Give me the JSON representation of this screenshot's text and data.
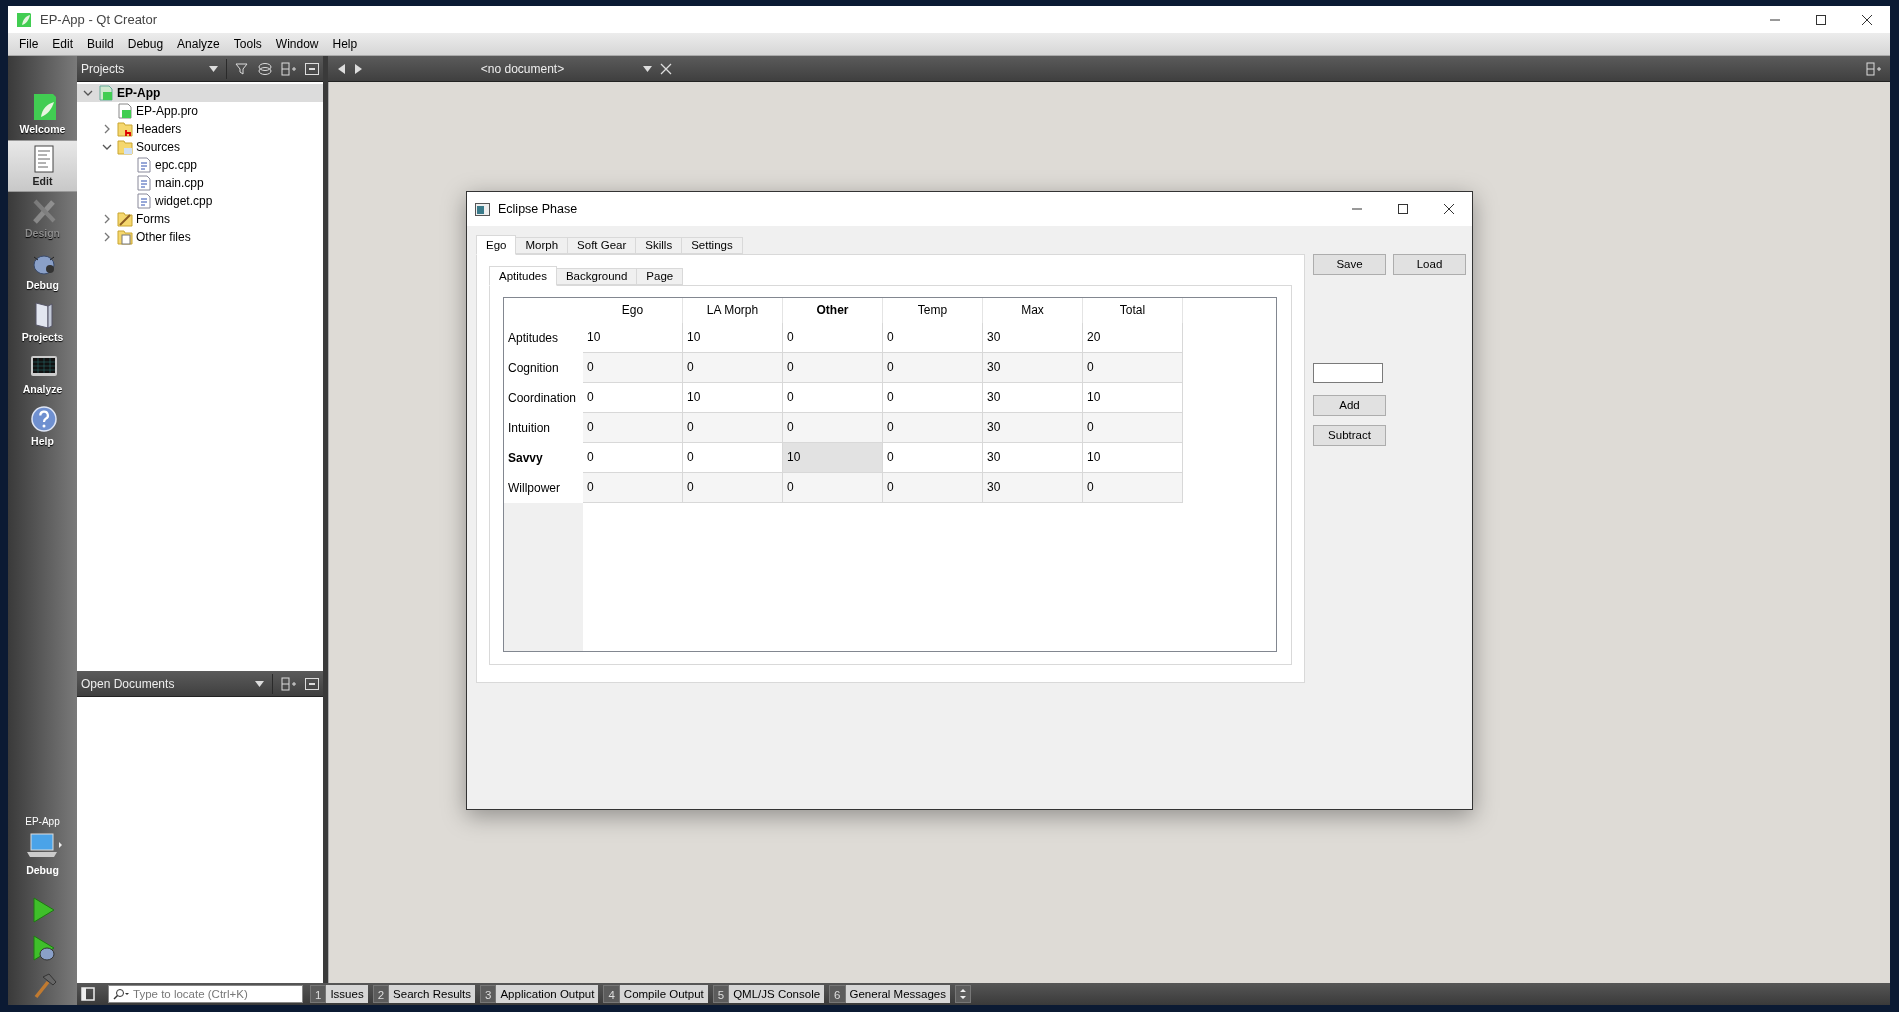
{
  "window": {
    "title": "EP-App - Qt Creator"
  },
  "menu": [
    "File",
    "Edit",
    "Build",
    "Debug",
    "Analyze",
    "Tools",
    "Window",
    "Help"
  ],
  "modes": [
    {
      "label": "Welcome",
      "kind": "welcome",
      "selected": false,
      "disabled": false
    },
    {
      "label": "Edit",
      "kind": "edit",
      "selected": true,
      "disabled": false
    },
    {
      "label": "Design",
      "kind": "design",
      "selected": false,
      "disabled": true
    },
    {
      "label": "Debug",
      "kind": "debug",
      "selected": false,
      "disabled": false
    },
    {
      "label": "Projects",
      "kind": "projects",
      "selected": false,
      "disabled": false
    },
    {
      "label": "Analyze",
      "kind": "analyze",
      "selected": false,
      "disabled": false
    },
    {
      "label": "Help",
      "kind": "help",
      "selected": false,
      "disabled": false
    }
  ],
  "target": {
    "project": "EP-App",
    "config": "Debug"
  },
  "projects_panel": {
    "title": "Projects",
    "tree": [
      {
        "label": "EP-App",
        "kind": "project",
        "selected": true,
        "expanded": true,
        "children": [
          {
            "label": "EP-App.pro",
            "kind": "pro",
            "selected": false
          },
          {
            "label": "Headers",
            "kind": "headers",
            "selected": false,
            "expanded": false
          },
          {
            "label": "Sources",
            "kind": "sources",
            "selected": false,
            "expanded": true,
            "children": [
              {
                "label": "epc.cpp",
                "kind": "cpp",
                "selected": false
              },
              {
                "label": "main.cpp",
                "kind": "cpp",
                "selected": false
              },
              {
                "label": "widget.cpp",
                "kind": "cpp",
                "selected": false
              }
            ]
          },
          {
            "label": "Forms",
            "kind": "forms",
            "selected": false,
            "expanded": false
          },
          {
            "label": "Other files",
            "kind": "other",
            "selected": false,
            "expanded": false
          }
        ]
      }
    ]
  },
  "open_documents": {
    "title": "Open Documents"
  },
  "editor": {
    "document": "<no document>"
  },
  "dialog": {
    "title": "Eclipse Phase",
    "tabs": [
      {
        "label": "Ego",
        "selected": true
      },
      {
        "label": "Morph",
        "selected": false
      },
      {
        "label": "Soft Gear",
        "selected": false
      },
      {
        "label": "Skills",
        "selected": false
      },
      {
        "label": "Settings",
        "selected": false
      }
    ],
    "subtabs": [
      {
        "label": "Aptitudes",
        "selected": true
      },
      {
        "label": "Background",
        "selected": false
      },
      {
        "label": "Page",
        "selected": false
      }
    ],
    "table": {
      "columns": [
        {
          "label": "Ego",
          "current": false
        },
        {
          "label": "LA Morph",
          "current": false
        },
        {
          "label": "Other",
          "current": true
        },
        {
          "label": "Temp",
          "current": false
        },
        {
          "label": "Max",
          "current": false
        },
        {
          "label": "Total",
          "current": false
        }
      ],
      "rows": [
        {
          "label": "Aptitudes",
          "current": false,
          "cells": [
            {
              "value": "10",
              "selected": false
            },
            {
              "value": "10",
              "selected": false
            },
            {
              "value": "0",
              "selected": false
            },
            {
              "value": "0",
              "selected": false
            },
            {
              "value": "30",
              "selected": false
            },
            {
              "value": "20",
              "selected": false
            }
          ]
        },
        {
          "label": "Cognition",
          "current": false,
          "cells": [
            {
              "value": "0",
              "selected": false
            },
            {
              "value": "0",
              "selected": false
            },
            {
              "value": "0",
              "selected": false
            },
            {
              "value": "0",
              "selected": false
            },
            {
              "value": "30",
              "selected": false
            },
            {
              "value": "0",
              "selected": false
            }
          ]
        },
        {
          "label": "Coordination",
          "current": false,
          "cells": [
            {
              "value": "0",
              "selected": false
            },
            {
              "value": "10",
              "selected": false
            },
            {
              "value": "0",
              "selected": false
            },
            {
              "value": "0",
              "selected": false
            },
            {
              "value": "30",
              "selected": false
            },
            {
              "value": "10",
              "selected": false
            }
          ]
        },
        {
          "label": "Intuition",
          "current": false,
          "cells": [
            {
              "value": "0",
              "selected": false
            },
            {
              "value": "0",
              "selected": false
            },
            {
              "value": "0",
              "selected": false
            },
            {
              "value": "0",
              "selected": false
            },
            {
              "value": "30",
              "selected": false
            },
            {
              "value": "0",
              "selected": false
            }
          ]
        },
        {
          "label": "Savvy",
          "current": true,
          "cells": [
            {
              "value": "0",
              "selected": false
            },
            {
              "value": "0",
              "selected": false
            },
            {
              "value": "10",
              "selected": true
            },
            {
              "value": "0",
              "selected": false
            },
            {
              "value": "30",
              "selected": false
            },
            {
              "value": "10",
              "selected": false
            }
          ]
        },
        {
          "label": "Willpower",
          "current": false,
          "cells": [
            {
              "value": "0",
              "selected": false
            },
            {
              "value": "0",
              "selected": false
            },
            {
              "value": "0",
              "selected": false
            },
            {
              "value": "0",
              "selected": false
            },
            {
              "value": "30",
              "selected": false
            },
            {
              "value": "0",
              "selected": false
            }
          ]
        }
      ]
    },
    "file_buttons": [
      "Save",
      "Load"
    ],
    "adjust_buttons": [
      "Add",
      "Subtract"
    ]
  },
  "locator": {
    "placeholder": "Type to locate (Ctrl+K)"
  },
  "output_panes": [
    {
      "number": "1",
      "label": "Issues"
    },
    {
      "number": "2",
      "label": "Search Results"
    },
    {
      "number": "3",
      "label": "Application Output"
    },
    {
      "number": "4",
      "label": "Compile Output"
    },
    {
      "number": "5",
      "label": "QML/JS Console"
    },
    {
      "number": "6",
      "label": "General Messages"
    }
  ]
}
